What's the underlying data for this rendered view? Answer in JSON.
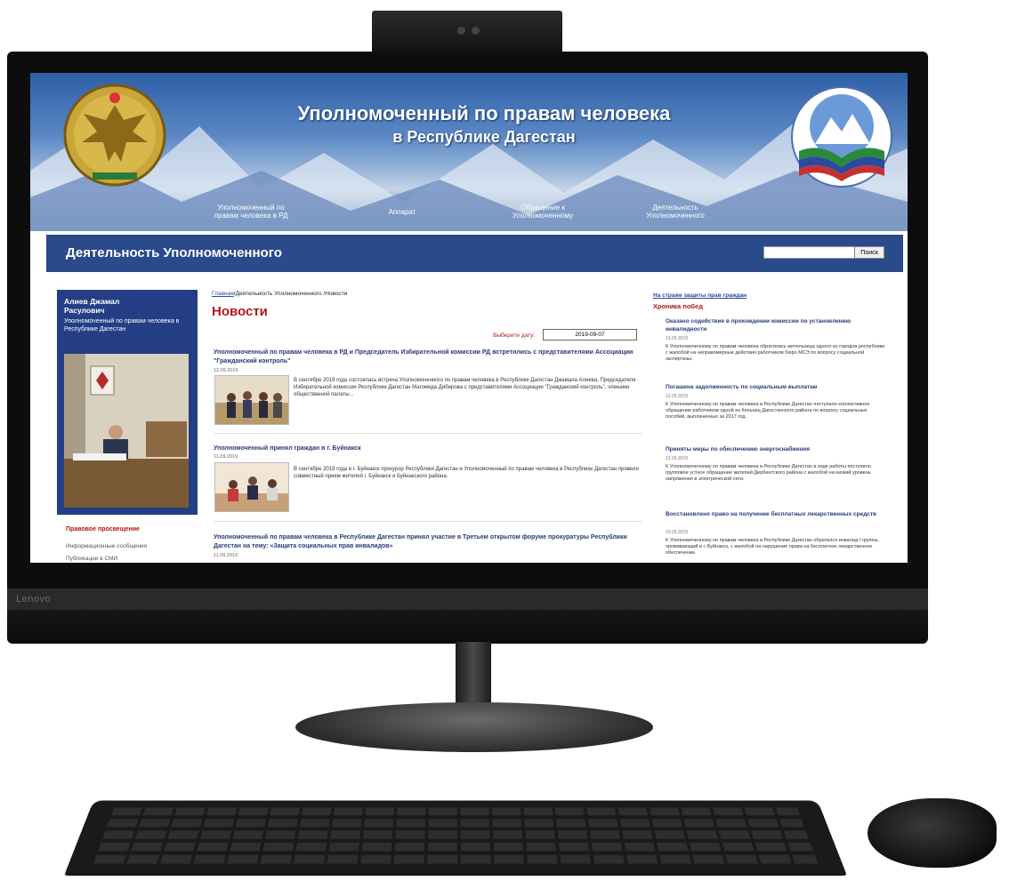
{
  "brand": {
    "device_logo": "Lenovo"
  },
  "header": {
    "title": "Уполномоченный по правам человека",
    "subtitle": "в Республике Дагестан"
  },
  "nav": [
    {
      "label": "Уполномоченный по правам человека в РД"
    },
    {
      "label": "Аппарат"
    },
    {
      "label": "Обращение к Уполномоченному"
    },
    {
      "label": "Деятельность Уполномоченного"
    }
  ],
  "section": {
    "title": "Деятельность Уполномоченного"
  },
  "search": {
    "button_label": "Поиск",
    "value": ""
  },
  "profile": {
    "name": "Алиев Джамал Расулович",
    "role": "Уполномоченный по правам человека в Республике Дагестан"
  },
  "left_menu": {
    "title": "Правовое просвещение",
    "items": [
      "Информационные сообщения",
      "Публикации в СМИ"
    ]
  },
  "breadcrumb": {
    "home": "Главная",
    "section": "Деятельность Уполномоченного",
    "current": "Новости"
  },
  "page_title": "Новости",
  "date_filter": {
    "label": "Выберите дату:",
    "value": "2019-09-07"
  },
  "news": [
    {
      "title": "Уполномоченный по правам человека в РД и Председатель Избирательной комиссии РД встретились с представителями Ассоциации \"Гражданский контроль\"",
      "date": "12.09.2019",
      "text": "В сентябре 2019 года состоялась встреча Уполномоченного по правам человека в Республике Дагестан Джамала Алиева, Председателя Избирательной комиссии Республики Дагестан Магомеда Дибирова с представителями Ассоциации \"Гражданский контроль\", членами общественной палаты..."
    },
    {
      "title": "Уполномоченный принял граждан в г. Буйнакск",
      "date": "11.09.2019",
      "text": "В сентябре 2019 года в г. Буйнакск прокурор Республики Дагестан и Уполномоченный по правам человека в Республике Дагестан провели совместный прием жителей г. Буйнакск и Буйнакского района."
    },
    {
      "title": "Уполномоченный по правам человека в Республике Дагестан принял участие в Третьем открытом форуме прокуратуры Республики Дагестан на тему: «Защита социальных прав инвалидов»",
      "date": "11.09.2019",
      "text": ""
    }
  ],
  "right": {
    "link": "На страже защиты прав граждан",
    "heading": "Хроника побед",
    "items": [
      {
        "title": "Оказано содействие в прохождении комиссии по установлению инвалидности",
        "date": "13.09.2019",
        "text": "К Уполномоченному по правам человека обратилась жительница одного из городов республики с жалобой на неправомерные действия работников бюро МСЭ по вопросу социальной экспертизы."
      },
      {
        "title": "Погашена задолженность по социальным выплатам",
        "date": "12.09.2019",
        "text": "К Уполномоченному по правам человека в Республике Дагестан поступило коллективное обращение работников одной из больниц Дагестанского района по вопросу социальных пособий, выплаченных за 2017 год."
      },
      {
        "title": "Приняты меры по обеспечению энергоснабжения",
        "date": "12.09.2019",
        "text": "К Уполномоченному по правам человека в Республике Дагестан в ходе работы поступило групповое устное обращение жителей Дербентского района с жалобой на низкий уровень напряжения в электрической сети."
      },
      {
        "title": "Восстановлено право на получение бесплатных лекарственных средств",
        "date": "10.09.2019",
        "text": "К Уполномоченному по правам человека в Республике Дагестан обратился инвалид I группы, проживающий в г. Буйнакск, с жалобой на нарушение права на бесплатное лекарственное обеспечение."
      }
    ]
  },
  "colors": {
    "header_blue": "#2d5fa6",
    "section_bar": "#2a4a8a",
    "title_red": "#b01818",
    "link_blue": "#2a4aa0",
    "profile_box": "#233e84"
  }
}
